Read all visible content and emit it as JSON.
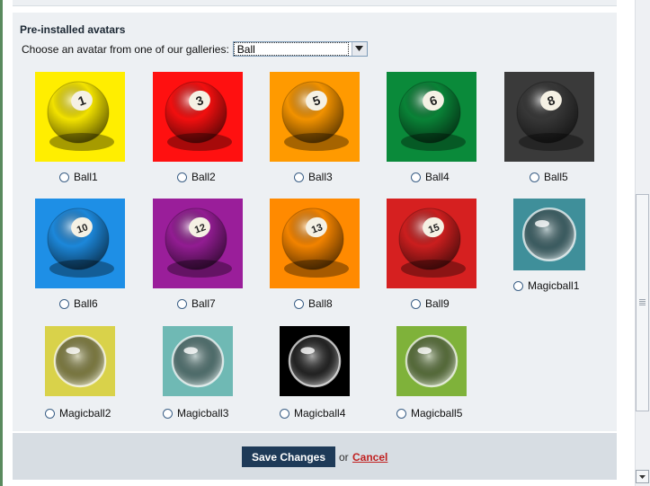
{
  "section": {
    "title": "Pre-installed avatars"
  },
  "gallery": {
    "label": "Choose an avatar from one of our galleries:",
    "selected": "Ball"
  },
  "avatars": [
    {
      "label": "Ball1",
      "number": "1",
      "color": "#ffee00"
    },
    {
      "label": "Ball2",
      "number": "3",
      "color": "#ff1010"
    },
    {
      "label": "Ball3",
      "number": "5",
      "color": "#ff9a00"
    },
    {
      "label": "Ball4",
      "number": "6",
      "color": "#0a8a3a"
    },
    {
      "label": "Ball5",
      "number": "8",
      "color": "#3a3a3a"
    },
    {
      "label": "Ball6",
      "number": "10",
      "color": "#1e8fe6"
    },
    {
      "label": "Ball7",
      "number": "12",
      "color": "#9a1e9a"
    },
    {
      "label": "Ball8",
      "number": "13",
      "color": "#ff8a00"
    },
    {
      "label": "Ball9",
      "number": "15",
      "color": "#d62020"
    },
    {
      "label": "Magicball1",
      "color": "#3f8f9a"
    },
    {
      "label": "Magicball2",
      "color": "#d9d24a"
    },
    {
      "label": "Magicball3",
      "color": "#6fb9b4"
    },
    {
      "label": "Magicball4",
      "color": "#000000"
    },
    {
      "label": "Magicball5",
      "color": "#7fb23a"
    }
  ],
  "actions": {
    "save_label": "Save Changes",
    "or_text": "or",
    "cancel_label": "Cancel"
  }
}
